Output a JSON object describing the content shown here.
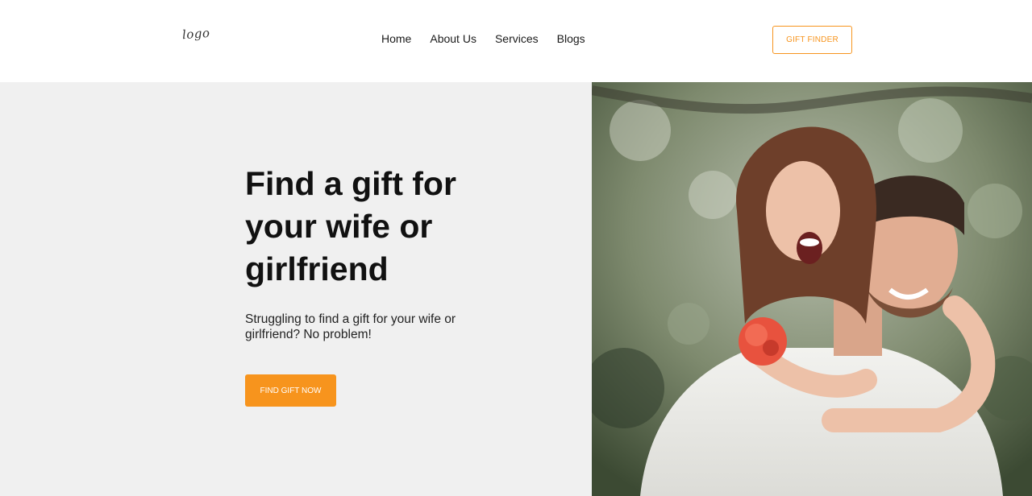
{
  "header": {
    "logo_text": "logo",
    "nav": [
      "Home",
      "About Us",
      "Services",
      "Blogs"
    ],
    "cta_label": "GIFT FINDER"
  },
  "hero": {
    "headline": "Find a gift for your wife or girlfriend",
    "subtext": "Struggling to find a gift for your wife or girlfriend? No problem!",
    "cta_label": "FIND GIFT NOW",
    "image_alt": "Smiling couple, woman riding piggyback on man, holding a coral flower"
  },
  "colors": {
    "accent": "#f7941d",
    "hero_bg": "#f0f0f0"
  }
}
